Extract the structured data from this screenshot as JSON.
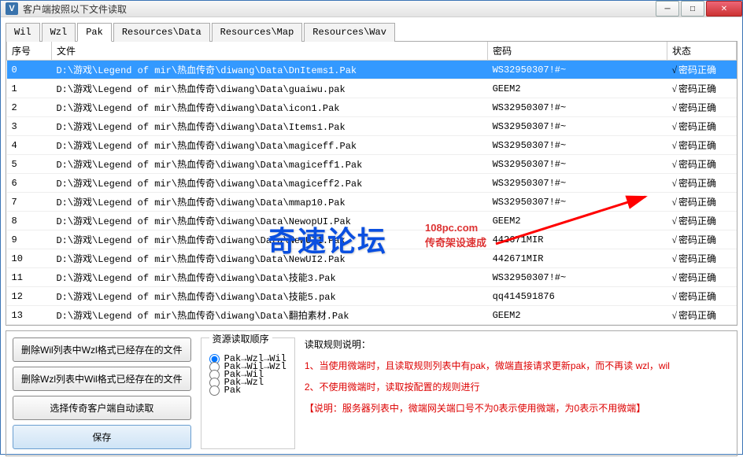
{
  "window": {
    "title": "客户端按照以下文件读取"
  },
  "tabs": [
    "Wil",
    "Wzl",
    "Pak",
    "Resources\\Data",
    "Resources\\Map",
    "Resources\\Wav"
  ],
  "active_tab": 2,
  "columns": {
    "idx": "序号",
    "file": "文件",
    "pwd": "密码",
    "status": "状态"
  },
  "rows": [
    {
      "idx": "0",
      "file": "D:\\游戏\\Legend of mir\\热血传奇\\diwang\\Data\\DnItems1.Pak",
      "pwd": "WS32950307!#~",
      "status": "密码正确",
      "sel": true
    },
    {
      "idx": "1",
      "file": "D:\\游戏\\Legend of mir\\热血传奇\\diwang\\Data\\guaiwu.pak",
      "pwd": "GEEM2",
      "status": "密码正确"
    },
    {
      "idx": "2",
      "file": "D:\\游戏\\Legend of mir\\热血传奇\\diwang\\Data\\icon1.Pak",
      "pwd": "WS32950307!#~",
      "status": "密码正确"
    },
    {
      "idx": "3",
      "file": "D:\\游戏\\Legend of mir\\热血传奇\\diwang\\Data\\Items1.Pak",
      "pwd": "WS32950307!#~",
      "status": "密码正确"
    },
    {
      "idx": "4",
      "file": "D:\\游戏\\Legend of mir\\热血传奇\\diwang\\Data\\magiceff.Pak",
      "pwd": "WS32950307!#~",
      "status": "密码正确"
    },
    {
      "idx": "5",
      "file": "D:\\游戏\\Legend of mir\\热血传奇\\diwang\\Data\\magiceff1.Pak",
      "pwd": "WS32950307!#~",
      "status": "密码正确"
    },
    {
      "idx": "6",
      "file": "D:\\游戏\\Legend of mir\\热血传奇\\diwang\\Data\\magiceff2.Pak",
      "pwd": "WS32950307!#~",
      "status": "密码正确"
    },
    {
      "idx": "7",
      "file": "D:\\游戏\\Legend of mir\\热血传奇\\diwang\\Data\\mmap10.Pak",
      "pwd": "WS32950307!#~",
      "status": "密码正确"
    },
    {
      "idx": "8",
      "file": "D:\\游戏\\Legend of mir\\热血传奇\\diwang\\Data\\NewopUI.Pak",
      "pwd": "GEEM2",
      "status": "密码正确"
    },
    {
      "idx": "9",
      "file": "D:\\游戏\\Legend of mir\\热血传奇\\diwang\\Data\\NewUI1.Pak",
      "pwd": "442671MIR",
      "status": "密码正确"
    },
    {
      "idx": "10",
      "file": "D:\\游戏\\Legend of mir\\热血传奇\\diwang\\Data\\NewUI2.Pak",
      "pwd": "442671MIR",
      "status": "密码正确"
    },
    {
      "idx": "11",
      "file": "D:\\游戏\\Legend of mir\\热血传奇\\diwang\\Data\\技能3.Pak",
      "pwd": "WS32950307!#~",
      "status": "密码正确"
    },
    {
      "idx": "12",
      "file": "D:\\游戏\\Legend of mir\\热血传奇\\diwang\\Data\\技能5.pak",
      "pwd": "qq414591876",
      "status": "密码正确"
    },
    {
      "idx": "13",
      "file": "D:\\游戏\\Legend of mir\\热血传奇\\diwang\\Data\\翻拍素材.Pak",
      "pwd": "GEEM2",
      "status": "密码正确"
    }
  ],
  "buttons": {
    "del_wil": "删除Wil列表中Wzl格式已经存在的文件",
    "del_wzl": "删除Wzl列表中Wil格式已经存在的文件",
    "auto_read": "选择传奇客户端自动读取",
    "save": "保存"
  },
  "order": {
    "title": "资源读取顺序",
    "options": [
      "Pak→Wzl→Wil",
      "Pak→Wil→Wzl",
      "Pak→Wil",
      "Pak→Wzl",
      "Pak"
    ],
    "selected": 0
  },
  "rules": {
    "title": "读取规则说明：",
    "line1": "1、当使用微端时，且读取规则列表中有pak，微端直接请求更新pak，而不再读 wzl，wil",
    "line2": "2、不使用微端时，读取按配置的规则进行",
    "note": "【说明：服务器列表中，微端网关端口号不为0表示使用微端，为0表示不用微端】"
  },
  "watermark": {
    "main": "奇速论坛",
    "url": "108pc.com",
    "sub": "传奇架设速成"
  }
}
